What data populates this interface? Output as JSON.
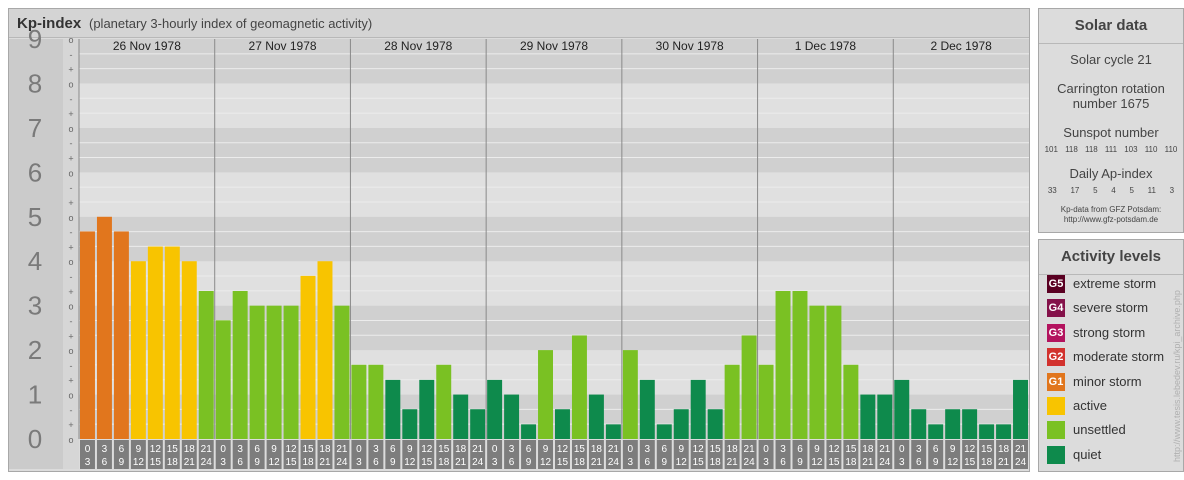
{
  "header": {
    "title": "Kp-index",
    "subtitle": "(planetary 3-hourly index of geomagnetic activity)"
  },
  "chart_data": {
    "type": "bar",
    "title": "Kp-index",
    "subtitle": "(planetary 3-hourly index of geomagnetic activity)",
    "y_tick_labels": [
      "0",
      "1",
      "2",
      "3",
      "4",
      "5",
      "6",
      "7",
      "8",
      "9"
    ],
    "y_minor_labels": [
      "o",
      "+",
      "-"
    ],
    "ylim": [
      0,
      9
    ],
    "grid": true,
    "days": [
      "26 Nov 1978",
      "27 Nov 1978",
      "28 Nov 1978",
      "29 Nov 1978",
      "30 Nov 1978",
      "1 Dec 1978",
      "2 Dec 1978"
    ],
    "hour_ranges": [
      [
        "0",
        "3"
      ],
      [
        "3",
        "6"
      ],
      [
        "6",
        "9"
      ],
      [
        "9",
        "12"
      ],
      [
        "12",
        "15"
      ],
      [
        "15",
        "18"
      ],
      [
        "18",
        "21"
      ],
      [
        "21",
        "24"
      ]
    ],
    "values": [
      4.67,
      5.0,
      4.67,
      4.0,
      4.33,
      4.33,
      4.0,
      3.33,
      2.67,
      3.33,
      3.0,
      3.0,
      3.0,
      3.67,
      4.0,
      3.0,
      1.67,
      1.67,
      1.33,
      0.67,
      1.33,
      1.67,
      1.0,
      0.67,
      1.33,
      1.0,
      0.33,
      2.0,
      0.67,
      2.33,
      1.0,
      0.33,
      2.0,
      1.33,
      0.33,
      0.67,
      1.33,
      0.67,
      1.67,
      2.33,
      1.67,
      3.33,
      3.33,
      3.0,
      3.0,
      1.67,
      1.0,
      1.0,
      1.33,
      0.67,
      0.33,
      0.67,
      0.67,
      0.33,
      0.33,
      1.33
    ]
  },
  "solar_data": {
    "title": "Solar data",
    "solar_cycle": "Solar cycle 21",
    "carrington_line1": "Carrington rotation",
    "carrington_line2": "number 1675",
    "sunspot_title": "Sunspot number",
    "sunspot_values": [
      "101",
      "118",
      "118",
      "111",
      "103",
      "110",
      "110"
    ],
    "ap_title": "Daily Ap-index",
    "ap_values": [
      "33",
      "17",
      "5",
      "4",
      "5",
      "11",
      "3"
    ],
    "credit_line1": "Kp-data from GFZ Potsdam:",
    "credit_line2": "http://www.gfz-potsdam.de"
  },
  "activity_levels": {
    "title": "Activity levels",
    "items": [
      {
        "badge": "G5",
        "label": "extreme storm",
        "color": "#5a0022"
      },
      {
        "badge": "G4",
        "label": "severe storm",
        "color": "#84124a"
      },
      {
        "badge": "G3",
        "label": "strong storm",
        "color": "#b3135e"
      },
      {
        "badge": "G2",
        "label": "moderate storm",
        "color": "#d2322e"
      },
      {
        "badge": "G1",
        "label": "minor storm",
        "color": "#e1761d"
      },
      {
        "badge": "",
        "label": "active",
        "color": "#f8c400"
      },
      {
        "badge": "",
        "label": "unsettled",
        "color": "#7ac123"
      },
      {
        "badge": "",
        "label": "quiet",
        "color": "#0e8a4c"
      }
    ]
  },
  "watermark": "http://www.tesis.lebedev.ru/kpi_archive.php"
}
